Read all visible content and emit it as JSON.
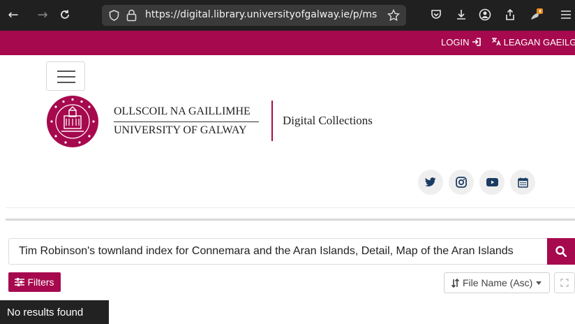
{
  "browser": {
    "url": "https://digital.library.universityofgalway.ie/p/ms",
    "back_icon": "←",
    "forward_icon": "→",
    "reload_icon": "C"
  },
  "topbar": {
    "login_label": "LOGIN",
    "language_label": "LEAGAN GAEILGE"
  },
  "header": {
    "brand_irish": "OLLSCOIL NA GAILLIMHE",
    "brand_english": "UNIVERSITY OF GALWAY",
    "site_name": "Digital Collections"
  },
  "search": {
    "value": "Tim Robinson's townland index for Connemara and the Aran Islands, Detail, Map of the Aran Islands"
  },
  "toolbar": {
    "filters_label": "Filters",
    "sort_label": "File Name (Asc)"
  },
  "results": {
    "message": "No results found"
  },
  "colors": {
    "brand": "#a6094e",
    "social_icon": "#1a3c63"
  }
}
